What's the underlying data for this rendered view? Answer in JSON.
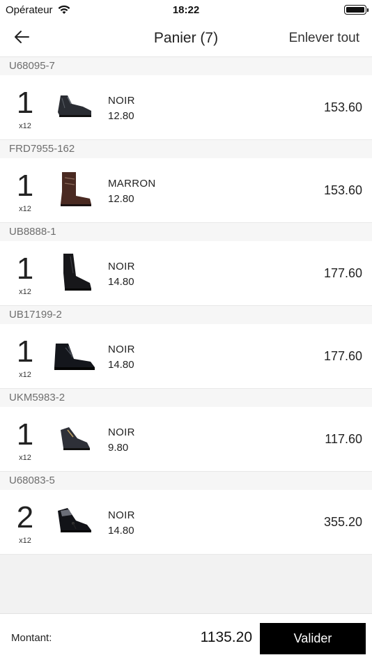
{
  "status_bar": {
    "carrier": "Opérateur",
    "time": "18:22"
  },
  "nav": {
    "title": "Panier (7)",
    "clear_label": "Enlever tout"
  },
  "cart": {
    "groups": [
      {
        "ref": "U68095-7",
        "qty": "1",
        "multiplier": "x12",
        "color": "NOIR",
        "unit_price": "12.80",
        "total": "153.60",
        "shoe_icon": "oxford-shoe-icon"
      },
      {
        "ref": "FRD7955-162",
        "qty": "1",
        "multiplier": "x12",
        "color": "MARRON",
        "unit_price": "12.80",
        "total": "153.60",
        "shoe_icon": "brown-boot-icon"
      },
      {
        "ref": "UB8888-1",
        "qty": "1",
        "multiplier": "x12",
        "color": "NOIR",
        "unit_price": "14.80",
        "total": "177.60",
        "shoe_icon": "chelsea-boot-icon"
      },
      {
        "ref": "UB17199-2",
        "qty": "1",
        "multiplier": "x12",
        "color": "NOIR",
        "unit_price": "14.80",
        "total": "177.60",
        "shoe_icon": "lace-boot-icon"
      },
      {
        "ref": "UKM5983-2",
        "qty": "1",
        "multiplier": "x12",
        "color": "NOIR",
        "unit_price": "9.80",
        "total": "117.60",
        "shoe_icon": "loafer-icon"
      },
      {
        "ref": "U68083-5",
        "qty": "2",
        "multiplier": "x12",
        "color": "NOIR",
        "unit_price": "14.80",
        "total": "355.20",
        "shoe_icon": "tassel-loafer-icon"
      }
    ]
  },
  "footer": {
    "amount_label": "Montant:",
    "amount_value": "1135.20",
    "validate_label": "Valider"
  },
  "colors": {
    "accent": "#000000",
    "background": "#f2f2f2",
    "header_bg": "#f6f6f6"
  }
}
